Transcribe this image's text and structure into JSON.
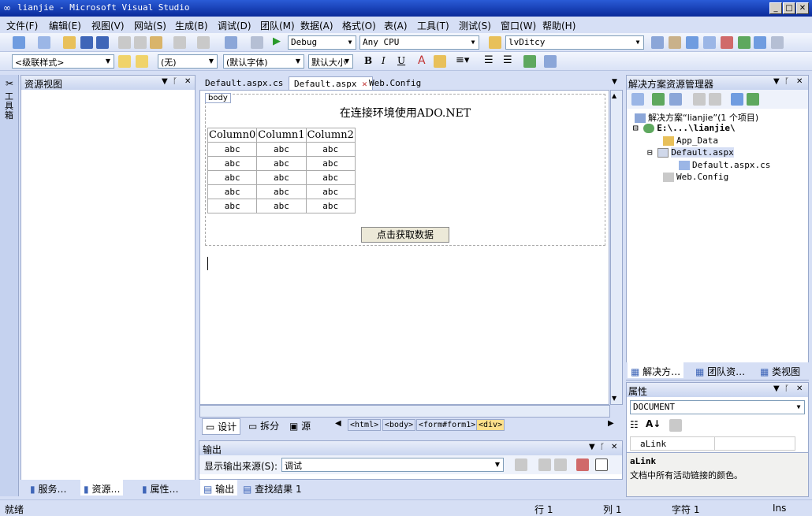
{
  "title": "lianjie - Microsoft Visual Studio",
  "menu": [
    "文件(F)",
    "编辑(E)",
    "视图(V)",
    "网站(S)",
    "生成(B)",
    "调试(D)",
    "团队(M)",
    "数据(A)",
    "格式(O)",
    "表(A)",
    "工具(T)",
    "测试(S)",
    "窗口(W)",
    "帮助(H)"
  ],
  "toolbar1": {
    "config": "Debug",
    "platform": "Any CPU",
    "find": "lvDitcy"
  },
  "toolbar2": {
    "block": "<级联样式>",
    "style": "(无)",
    "font": "(默认字体)",
    "size": "默认大小"
  },
  "left_panel": {
    "title": "资源视图",
    "toolbox_tab": "工具箱",
    "bottom_tabs": [
      "服务…",
      "资源…",
      "属性…"
    ]
  },
  "editor": {
    "tabs": [
      "Default.aspx.cs",
      "Default.aspx",
      "Web.Config"
    ],
    "tag_label": "body",
    "heading": "在连接环境使用ADO.NET",
    "table_headers": [
      "Column0",
      "Column1",
      "Column2"
    ],
    "table_rows": [
      [
        "abc",
        "abc",
        "abc"
      ],
      [
        "abc",
        "abc",
        "abc"
      ],
      [
        "abc",
        "abc",
        "abc"
      ],
      [
        "abc",
        "abc",
        "abc"
      ],
      [
        "abc",
        "abc",
        "abc"
      ]
    ],
    "button_label": "点击获取数据",
    "view_tabs": [
      "设计",
      "拆分",
      "源"
    ],
    "breadcrumbs": [
      "<html>",
      "<body>",
      "<form#form1>",
      "<div>"
    ]
  },
  "output": {
    "title": "输出",
    "source_label": "显示输出来源(S):",
    "source_value": "调试",
    "tabs": [
      "输出",
      "查找结果 1"
    ]
  },
  "solution": {
    "title": "解决方案资源管理器",
    "root": "解决方案“lianjie”(1 个项目)",
    "project": "E:\\...\\lianjie\\",
    "items": [
      "App_Data",
      "Default.aspx",
      "Default.aspx.cs",
      "Web.Config"
    ],
    "bottom_tabs": [
      "解决方…",
      "团队资…",
      "类视图"
    ]
  },
  "properties": {
    "title": "属性",
    "object": "DOCUMENT",
    "prop_name": "aLink",
    "desc_title": "aLink",
    "desc_text": "文档中所有活动链接的颜色。"
  },
  "status": {
    "ready": "就绪",
    "line": "行 1",
    "col": "列 1",
    "char": "字符 1",
    "mode": "Ins"
  },
  "colors": {
    "title_bar": "#0a2a9a",
    "ide_bg": "#d6dff5",
    "selected_tab": "#ffffff"
  }
}
